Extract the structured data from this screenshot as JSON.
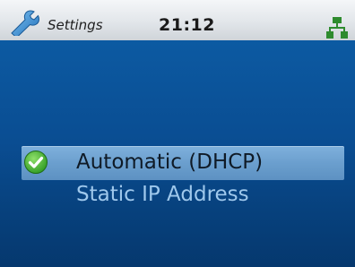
{
  "status_bar": {
    "app_name": "Settings",
    "app_icon": "wrench-icon",
    "time": "21:12",
    "network_icon": "network-connected-icon"
  },
  "ip_menu": {
    "options": [
      {
        "label": "Automatic (DHCP)",
        "selected": true,
        "icon": "check-icon"
      },
      {
        "label": "Static IP Address",
        "selected": false
      }
    ]
  },
  "colors": {
    "background_blue": "#0a4d92",
    "selection_highlight": "#6b9fce",
    "unselected_text": "#9fc8ec",
    "check_green": "#3fae2a",
    "network_green": "#2e8b2e"
  }
}
